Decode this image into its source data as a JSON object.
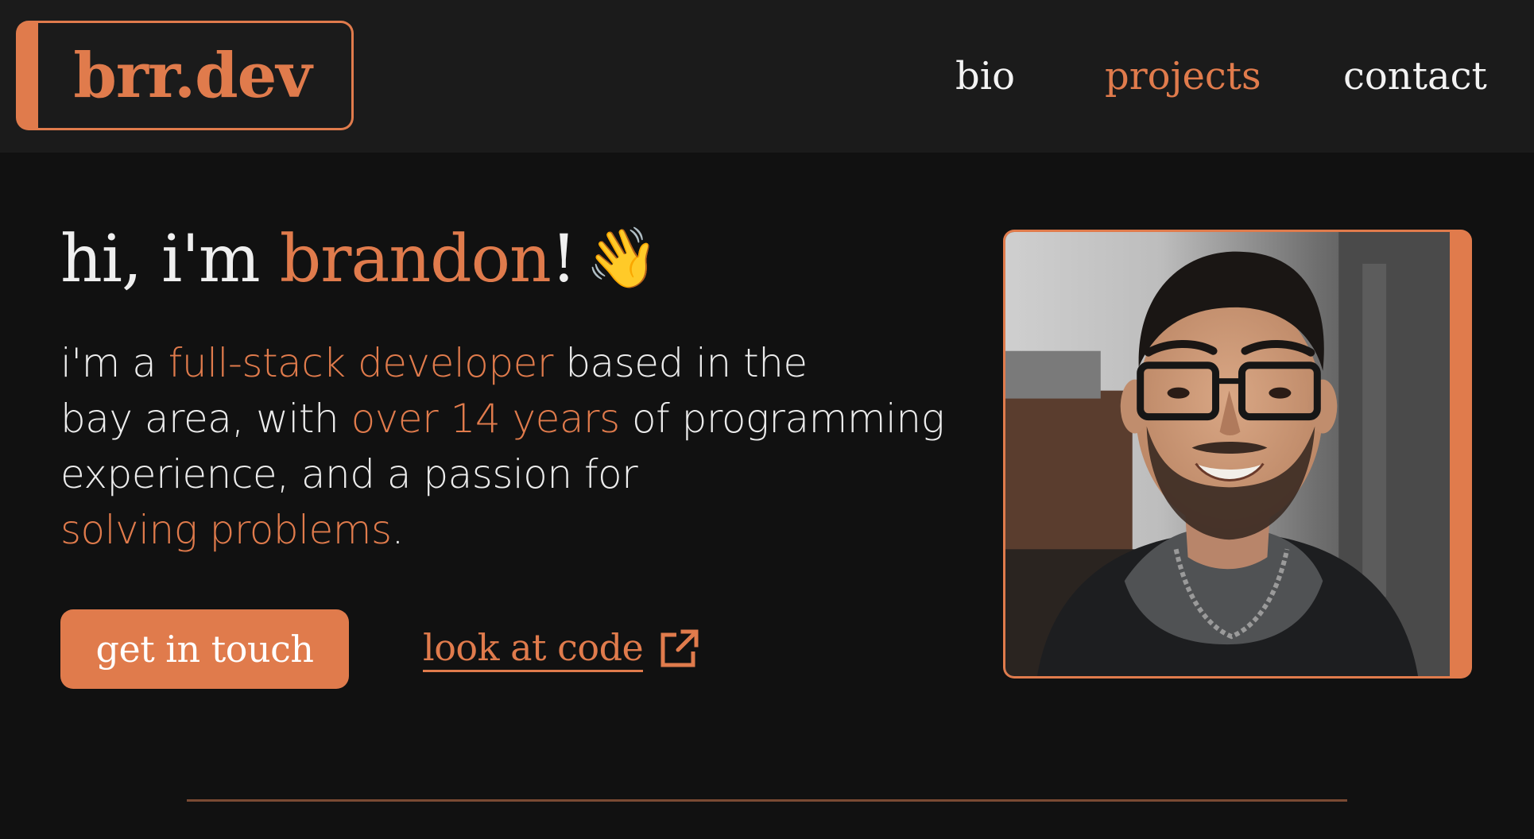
{
  "header": {
    "logo_text": "brr.dev",
    "nav": [
      {
        "label": "bio",
        "active": false
      },
      {
        "label": "projects",
        "active": true
      },
      {
        "label": "contact",
        "active": false
      }
    ]
  },
  "hero": {
    "greeting_prefix": "hi, i'm ",
    "name": "brandon",
    "greeting_suffix": "!",
    "wave_emoji": "👋",
    "intro": {
      "part1": "i'm a ",
      "highlight1": "full-stack developer",
      "part2": " based in the",
      "part3": "bay area, with ",
      "highlight2": "over 14 years",
      "part4": " of programming",
      "part5": "experience, and a passion for",
      "highlight3": "solving problems",
      "part6": "."
    },
    "primary_button": "get in touch",
    "secondary_link": "look at code",
    "secondary_link_icon": "external-link-icon"
  },
  "colors": {
    "accent": "#e07b4c",
    "background": "#111111",
    "header_background": "#1b1b1b",
    "text": "#efefef"
  }
}
